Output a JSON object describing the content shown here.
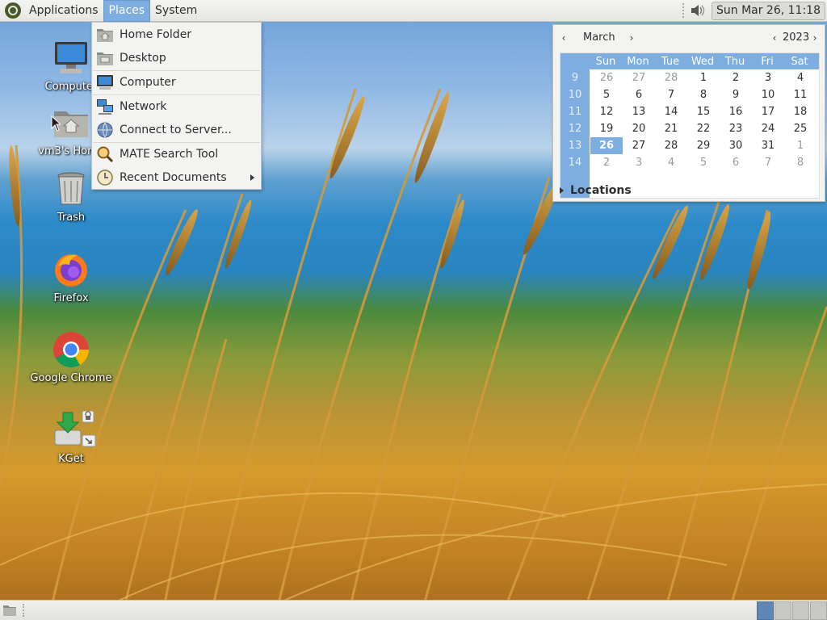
{
  "top_panel": {
    "menus": [
      {
        "label": "Applications"
      },
      {
        "label": "Places"
      },
      {
        "label": "System"
      }
    ],
    "clock": "Sun Mar 26, 11:18"
  },
  "places_menu": {
    "items": [
      {
        "label": "Home Folder",
        "icon": "home-folder-icon"
      },
      {
        "label": "Desktop",
        "icon": "desktop-folder-icon"
      },
      {
        "label": "Computer",
        "icon": "computer-icon"
      },
      {
        "label": "Network",
        "icon": "network-icon"
      },
      {
        "label": "Connect to Server...",
        "icon": "globe-icon"
      },
      {
        "label": "MATE Search Tool",
        "icon": "search-icon"
      },
      {
        "label": "Recent Documents",
        "icon": "clock-icon"
      }
    ]
  },
  "calendar": {
    "month": "March",
    "year": "2023",
    "day_headers": [
      "Sun",
      "Mon",
      "Tue",
      "Wed",
      "Thu",
      "Fri",
      "Sat"
    ],
    "weeks": [
      {
        "num": "9",
        "days": [
          "26",
          "27",
          "28",
          "1",
          "2",
          "3",
          "4"
        ]
      },
      {
        "num": "10",
        "days": [
          "5",
          "6",
          "7",
          "8",
          "9",
          "10",
          "11"
        ]
      },
      {
        "num": "11",
        "days": [
          "12",
          "13",
          "14",
          "15",
          "16",
          "17",
          "18"
        ]
      },
      {
        "num": "12",
        "days": [
          "19",
          "20",
          "21",
          "22",
          "23",
          "24",
          "25"
        ]
      },
      {
        "num": "13",
        "days": [
          "26",
          "27",
          "28",
          "29",
          "30",
          "31",
          "1"
        ]
      },
      {
        "num": "14",
        "days": [
          "2",
          "3",
          "4",
          "5",
          "6",
          "7",
          "8"
        ]
      }
    ],
    "today": "26",
    "locations_label": "Locations"
  },
  "desktop_icons": [
    {
      "label": "Computer",
      "icon": "computer-icon"
    },
    {
      "label": "vm3's Home",
      "icon": "home-folder-icon"
    },
    {
      "label": "Trash",
      "icon": "trash-icon"
    },
    {
      "label": "Firefox",
      "icon": "firefox-icon"
    },
    {
      "label": "Google Chrome",
      "icon": "chrome-icon"
    },
    {
      "label": "KGet",
      "icon": "kget-icon"
    }
  ],
  "colors": {
    "accent": "#7eaee0",
    "panel": "#e6e6e3",
    "active_workspace": "#5e86b5"
  }
}
